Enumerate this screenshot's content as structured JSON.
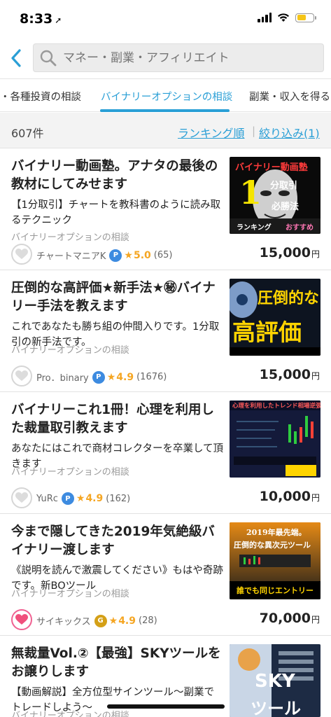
{
  "status": {
    "time": "8:33",
    "location_icon": "location-arrow-icon"
  },
  "search": {
    "placeholder": "マネー・副業・アフィリエイト"
  },
  "tabs": [
    {
      "label": "・各種投資の相談"
    },
    {
      "label": "バイナリーオプションの相談"
    },
    {
      "label": "副業・収入を得る"
    }
  ],
  "result_count": "607件",
  "sort": {
    "ranking": "ランキング順",
    "filter": "絞り込み(1)",
    "separator": "|"
  },
  "accent_color": "#2a9fd6",
  "items": [
    {
      "title": "バイナリー動画塾。アナタの最後の教材にしてみせます",
      "desc": "【1分取引】チャートを教科書のように読み取るテクニック",
      "category": "バイナリーオプションの相談",
      "seller": "チャートマニアK",
      "rating": "5.0",
      "reviews": "(65)",
      "price": "15,000",
      "yen": "円",
      "favorited": false,
      "thumb_text": [
        "バイナリー動画塾",
        "1",
        "分取引",
        "必勝法",
        "ランキング",
        "おすすめ"
      ]
    },
    {
      "title": "圧倒的な高評価★新手法★㊙バイナリー手法を教えます",
      "desc": "これであなたも勝ち組の仲間入りです。1分取引の新手法です。",
      "category": "バイナリーオプションの相談",
      "seller": "Pro．binary",
      "rating": "4.9",
      "reviews": "(1676)",
      "price": "15,000",
      "yen": "円",
      "favorited": false,
      "thumb_text": [
        "圧倒的な",
        "高評価"
      ]
    },
    {
      "title": "バイナリーこれ1冊！心理を利用した裁量取引教えます",
      "desc": "あなたにはこれで商材コレクターを卒業して頂きます",
      "category": "バイナリーオプションの相談",
      "seller": "YuRc",
      "rating": "4.9",
      "reviews": "(162)",
      "price": "10,000",
      "yen": "円",
      "favorited": false,
      "thumb_text": [
        "心理を利用したトレンド相場逆張り"
      ]
    },
    {
      "title": "今まで隠してきた2019年気絶級バイナリー渡します",
      "desc": "《説明を読んで激震してください》もはや奇跡です。新BOツール",
      "category": "バイナリーオプションの相談",
      "seller": "サイキックス",
      "rating": "4.9",
      "reviews": "(28)",
      "price": "70,000",
      "yen": "円",
      "favorited": true,
      "thumb_text": [
        "2019年最先端。",
        "圧倒的な異次元ツール",
        "誰でも同じエントリー"
      ]
    },
    {
      "title": "無裁量Vol.②【最強】SKYツールをお譲りします",
      "desc": "【動画解説】全方位型サインツール〜副業でトレードしよう〜",
      "category": "バイナリーオプションの相談",
      "thumb_text": [
        "SKY",
        "ツール"
      ]
    }
  ]
}
